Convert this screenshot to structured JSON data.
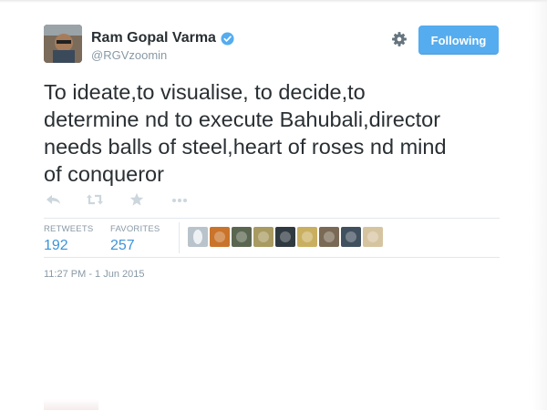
{
  "user": {
    "name": "Ram Gopal Varma",
    "handle": "@RGVzoomin",
    "verified": true
  },
  "follow_button": {
    "label": "Following"
  },
  "tweet": {
    "text": "To ideate,to visualise, to decide,to\ndetermine nd to execute Bahubali,director\nneeds balls of steel,heart of roses nd mind\nof conqueror"
  },
  "actions": {
    "icons": [
      "reply-icon",
      "retweet-icon",
      "favorite-icon",
      "more-icon"
    ]
  },
  "stats": {
    "retweets_label": "RETWEETS",
    "retweets_value": "192",
    "favorites_label": "FAVORITES",
    "favorites_value": "257"
  },
  "favoriters": [
    {
      "avatar_color": "#b9c3cc"
    },
    {
      "avatar_color": "#c9742a"
    },
    {
      "avatar_color": "#5b6650"
    },
    {
      "avatar_color": "#a89a60"
    },
    {
      "avatar_color": "#2f3a40"
    },
    {
      "avatar_color": "#c9b060"
    },
    {
      "avatar_color": "#7a6a55"
    },
    {
      "avatar_color": "#40505e"
    },
    {
      "avatar_color": "#d6c4a0"
    }
  ],
  "timestamp": "11:27 PM - 1 Jun 2015",
  "colors": {
    "accent": "#55acee",
    "text": "#292f33",
    "muted": "#8899a6",
    "link_count": "#3b94d9",
    "verified": "#55acee"
  }
}
